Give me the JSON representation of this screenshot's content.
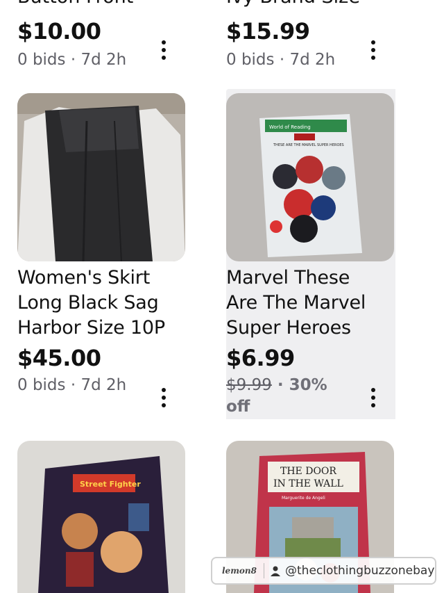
{
  "listings": [
    {
      "title_lines": [
        "Button  Front"
      ],
      "price": "$10.00",
      "meta": "0 bids · 7d 2h"
    },
    {
      "title_lines": [
        "Ivy Brand Size"
      ],
      "price": "$15.99",
      "meta": "0 bids · 7d 2h"
    },
    {
      "title_lines": [
        "Women's Skirt",
        "Long Black Sag",
        "Harbor Size 10P"
      ],
      "price": "$45.00",
      "meta": "0 bids · 7d 2h"
    },
    {
      "title_lines": [
        "Marvel These",
        "Are The Marvel",
        "Super Heroes"
      ],
      "price": "$6.99",
      "original_price": "$9.99",
      "discount_line1": " · 30%",
      "discount_line2": "off",
      "book_series": "World of Reading",
      "book_title": "THESE ARE THE MARVEL SUPER HEROES"
    },
    {
      "book_logo": "Street Fighter"
    },
    {
      "book_title_line1": "THE DOOR",
      "book_title_line2": "IN THE WALL",
      "book_author": "Marguerite de Angeli"
    }
  ],
  "watermark": {
    "logo": "lemon8",
    "handle": "@theclothingbuzzonebay"
  },
  "colors": {
    "highlight_bg": "#efeff1",
    "meta_text": "#5f5f66"
  }
}
